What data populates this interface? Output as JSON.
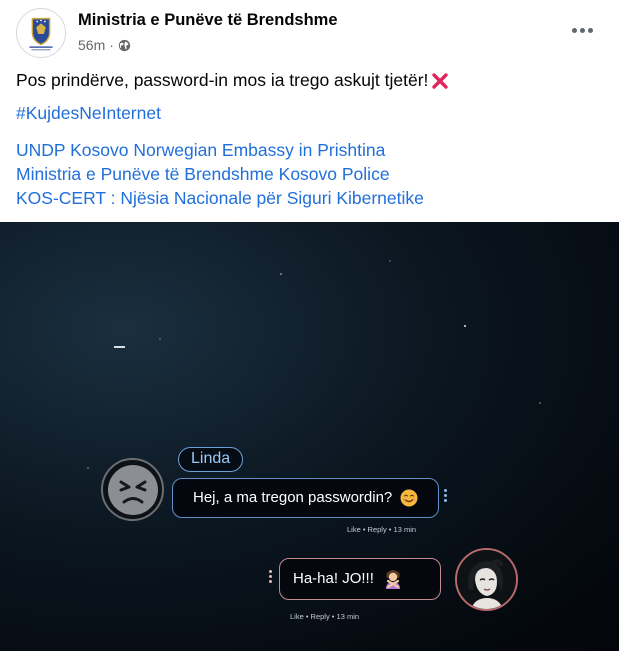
{
  "post": {
    "page_name": "Ministria e Punëve të Brendshme",
    "time": "56m",
    "separator": "·",
    "caption": "Pos prindërve, password-in mos ia trego askujt tjetër!",
    "hashtag": "#KujdesNeInternet",
    "tags": {
      "line1_a": "UNDP Kosovo",
      "line1_b": "Norwegian Embassy in Prishtina",
      "line2_a": "Ministria e Punëve të Brendshme",
      "line2_b": "Kosovo Police",
      "line3": "KOS-CERT : Njësia Nacionale për Siguri Kibernetike"
    }
  },
  "icons": {
    "avatar": "kosovo-coat-of-arms-logo",
    "visibility": "globe-icon",
    "more": "more-options-icon",
    "caption_emoji": "cross-mark-icon",
    "bubble_emoji_left": "smiling-face-emoji",
    "bubble_emoji_right": "person-gesturing-no-emoji"
  },
  "chat": {
    "sender_name": "Linda",
    "message_left": "Hej, a ma tregon passwordin?",
    "meta_left": "Like • Reply • 13 min",
    "message_right": "Ha-ha! JO!!!",
    "meta_right": "Like • Reply • 13 min"
  },
  "colors": {
    "link": "#216fdb",
    "left_bubble_border": "#5e8fc7",
    "right_bubble_border": "#c38b8b"
  }
}
